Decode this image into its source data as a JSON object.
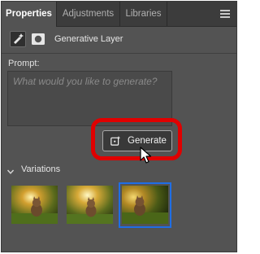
{
  "tabs": [
    {
      "label": "Properties",
      "active": true
    },
    {
      "label": "Adjustments",
      "active": false
    },
    {
      "label": "Libraries",
      "active": false
    }
  ],
  "layer": {
    "type_label": "Generative Layer",
    "icons": [
      "generative-layer-icon",
      "mask-icon"
    ]
  },
  "prompt": {
    "label": "Prompt:",
    "placeholder": "What would you like to generate?",
    "value": ""
  },
  "generate_button": {
    "label": "Generate",
    "icon": "sparkle-plus-icon"
  },
  "variations": {
    "label": "Variations",
    "expanded": true,
    "selected_index": 2,
    "items": [
      "variation-1",
      "variation-2",
      "variation-3"
    ]
  },
  "colors": {
    "panel": "#535353",
    "tabbar": "#3c3c3c",
    "highlight": "#e00000",
    "selection": "#1f6ee6"
  }
}
